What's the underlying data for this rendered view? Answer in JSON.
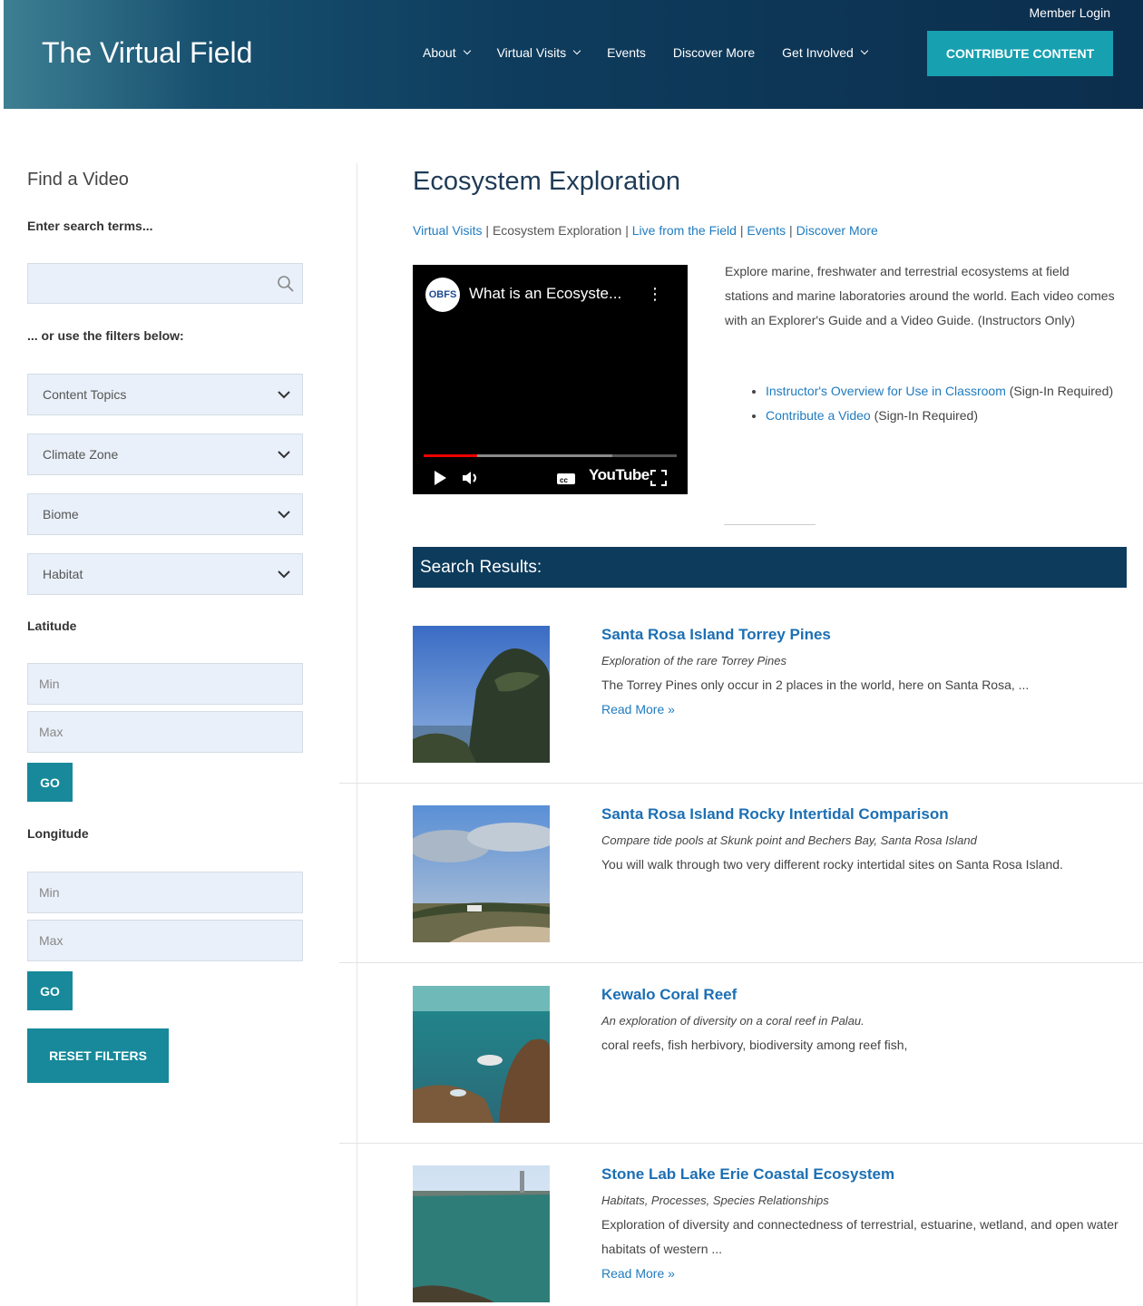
{
  "header": {
    "site_title": "The Virtual Field",
    "member_login": "Member Login",
    "nav": [
      {
        "label": "About",
        "has_dropdown": true
      },
      {
        "label": "Virtual Visits",
        "has_dropdown": true
      },
      {
        "label": "Events",
        "has_dropdown": false
      },
      {
        "label": "Discover More",
        "has_dropdown": false
      },
      {
        "label": "Get Involved",
        "has_dropdown": true
      }
    ],
    "contribute_label": "CONTRIBUTE CONTENT"
  },
  "sidebar": {
    "title": "Find a Video",
    "search_label": "Enter search terms...",
    "filters_label": "... or use the filters below:",
    "selects": [
      "Content Topics",
      "Climate Zone",
      "Biome",
      "Habitat"
    ],
    "latitude_label": "Latitude",
    "longitude_label": "Longitude",
    "min_placeholder": "Min",
    "max_placeholder": "Max",
    "go_label": "GO",
    "reset_label": "RESET FILTERS"
  },
  "main": {
    "title": "Ecosystem Exploration",
    "breadcrumb": [
      {
        "label": "Virtual Visits",
        "link": true
      },
      {
        "label": "Ecosystem Exploration",
        "link": false
      },
      {
        "label": "Live from the Field",
        "link": true
      },
      {
        "label": "Events",
        "link": true
      },
      {
        "label": "Discover More",
        "link": true
      }
    ],
    "video": {
      "logo_text": "OBFS",
      "title": "What is an Ecosyste...",
      "menu_icon": "more-vertical-icon",
      "brand": "YouTube"
    },
    "description": "Explore marine, freshwater and terrestrial ecosystems at field stations and marine laboratories around the world. Each video comes with an Explorer's Guide and a Video Guide. (Instructors Only)",
    "links": [
      {
        "label": "Instructor's Overview for Use in Classroom",
        "suffix": " (Sign-In Required)"
      },
      {
        "label": "Contribute a Video",
        "suffix": " (Sign-In Required)"
      }
    ],
    "results_heading": "Search Results:",
    "results": [
      {
        "title": "Santa Rosa Island Torrey Pines",
        "subtitle": "Exploration of the rare Torrey Pines",
        "text": "The Torrey Pines only occur in 2 places in the world, here on Santa Rosa, ...",
        "read_more": "Read More »"
      },
      {
        "title": "Santa Rosa Island Rocky Intertidal Comparison",
        "subtitle": "Compare tide pools at Skunk point and Bechers Bay, Santa Rosa Island",
        "text": "You will walk through two very different rocky intertidal sites on Santa Rosa Island.",
        "read_more": ""
      },
      {
        "title": "Kewalo Coral Reef",
        "subtitle": "An exploration of diversity on a coral reef in Palau.",
        "text": "coral reefs, fish herbivory, biodiversity among reef fish,",
        "read_more": ""
      },
      {
        "title": "Stone Lab Lake Erie Coastal Ecosystem",
        "subtitle": "Habitats, Processes, Species Relationships",
        "text": "Exploration of diversity and connectedness of terrestrial, estuarine, wetland, and open water habitats of western ...",
        "read_more": "Read More »"
      }
    ]
  },
  "colors": {
    "header_bg": "#0c2e4d",
    "accent": "#17a0b0",
    "button": "#17899a",
    "results_bar": "#0d3b5c",
    "link": "#1f7bbf"
  }
}
